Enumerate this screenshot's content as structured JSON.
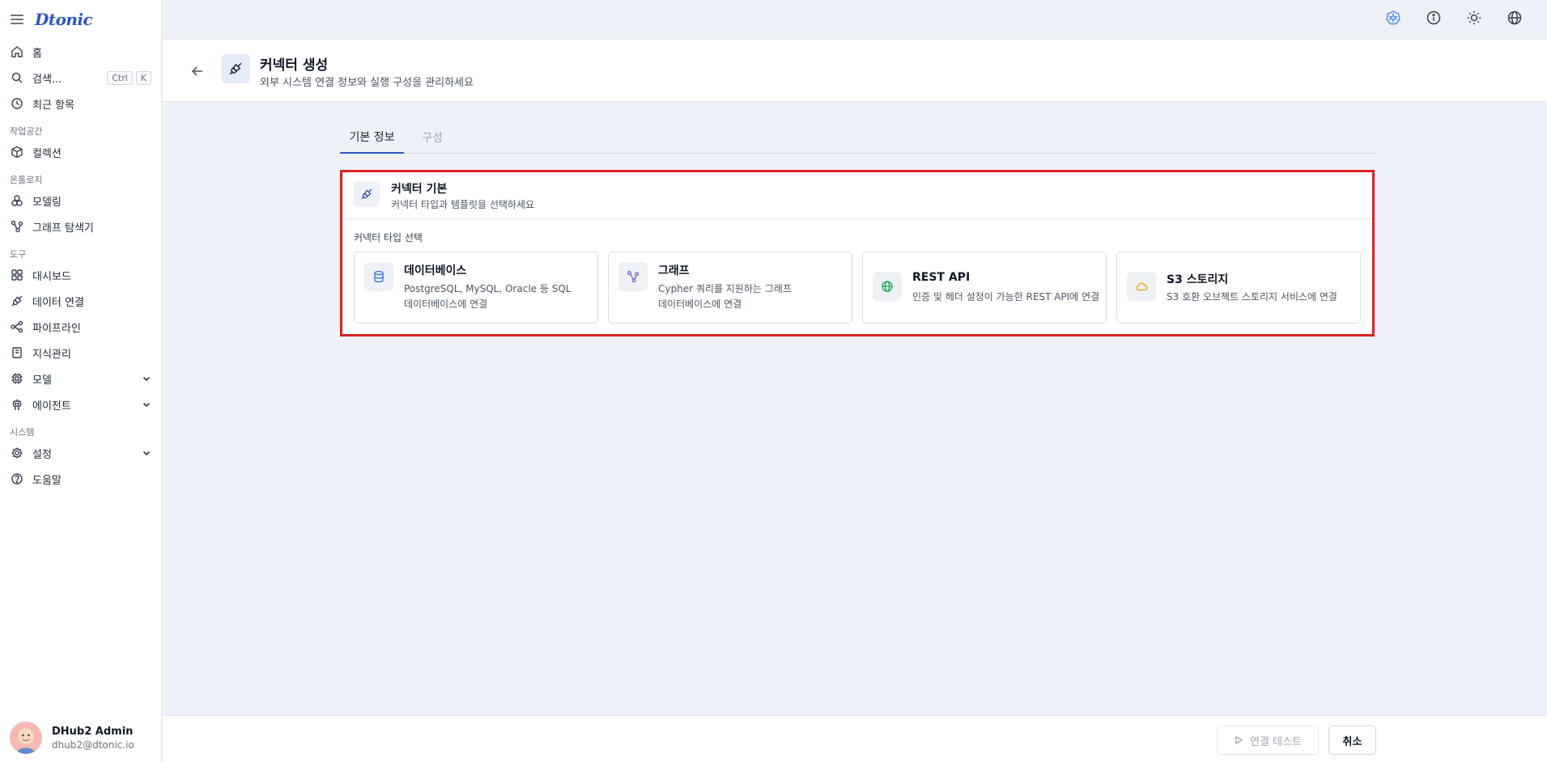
{
  "app": {
    "logo": "Dtonic"
  },
  "sidebar": {
    "items_top": [
      {
        "label": "홈",
        "icon": "home-icon"
      },
      {
        "label": "검색...",
        "icon": "search-icon",
        "shortcut": [
          "Ctrl",
          "K"
        ]
      },
      {
        "label": "최근 항목",
        "icon": "clock-icon"
      }
    ],
    "section_workspace": "작업공간",
    "items_workspace": [
      {
        "label": "컬렉션",
        "icon": "cube-icon"
      }
    ],
    "section_ontology": "온톨로지",
    "items_ontology": [
      {
        "label": "모델링",
        "icon": "shapes-icon"
      },
      {
        "label": "그래프 탐색기",
        "icon": "graph-icon"
      }
    ],
    "section_tools": "도구",
    "items_tools": [
      {
        "label": "대시보드",
        "icon": "dashboard-icon"
      },
      {
        "label": "데이터 연결",
        "icon": "plug-icon"
      },
      {
        "label": "파이프라인",
        "icon": "pipeline-icon"
      },
      {
        "label": "지식관리",
        "icon": "book-icon"
      },
      {
        "label": "모델",
        "icon": "chip-icon"
      },
      {
        "label": "에이전트",
        "icon": "robot-icon"
      }
    ],
    "section_system": "시스템",
    "items_system": [
      {
        "label": "설정",
        "icon": "gear-icon"
      },
      {
        "label": "도움말",
        "icon": "help-icon"
      }
    ],
    "user": {
      "name": "DHub2 Admin",
      "email": "dhub2@dtonic.io"
    }
  },
  "header": {
    "title": "커넥터 생성",
    "subtitle": "외부 시스템 연결 정보와 실행 구성을 관리하세요"
  },
  "tabs": [
    {
      "label": "기본 정보"
    },
    {
      "label": "구성"
    }
  ],
  "card": {
    "title": "커넥터 기본",
    "subtitle": "커넥터 타입과 템플릿을 선택하세요",
    "select_label": "커넥터 타입 선택",
    "types": [
      {
        "name": "데이터베이스",
        "desc_line1": "PostgreSQL, MySQL, Oracle 등 SQL",
        "desc_line2": "데이터베이스에 연결",
        "icon": "database-icon",
        "color": "#3b6fd8"
      },
      {
        "name": "그래프",
        "desc_line1": "Cypher 쿼리를 지원하는 그래프",
        "desc_line2": "데이터베이스에 연결",
        "icon": "graph-icon",
        "color": "#7c5cd6"
      },
      {
        "name": "REST API",
        "desc_line1": "인증 및 헤더 설정이 가능한 REST API에 연결",
        "icon": "globe-icon",
        "color": "#16a34a"
      },
      {
        "name": "S3 스토리지",
        "desc_line1": "S3 호환 오브젝트 스토리지 서비스에 연결",
        "icon": "cloud-icon",
        "color": "#f59e0b"
      }
    ]
  },
  "footer": {
    "test_label": "연결 테스트",
    "cancel_label": "취소"
  },
  "colors": {
    "accent": "#2f55c4",
    "highlight_border": "#d92121"
  }
}
